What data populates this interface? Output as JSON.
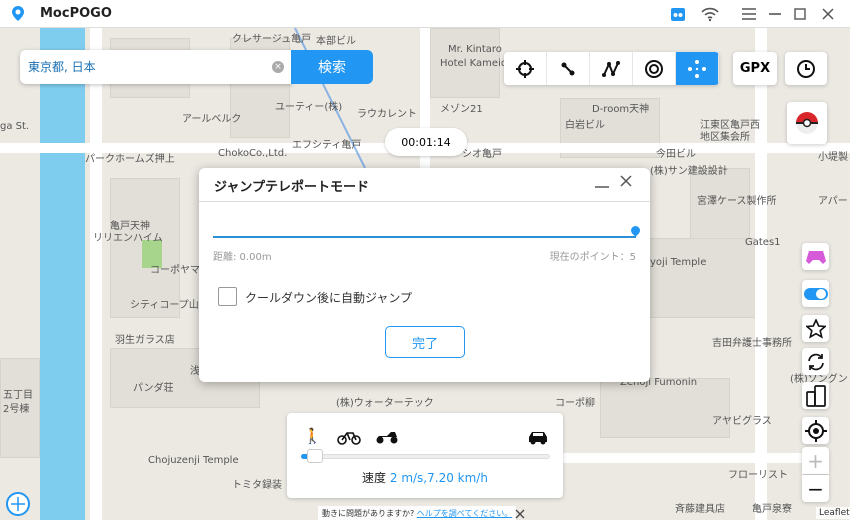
{
  "app": {
    "title": "MocPOGO"
  },
  "titlebar_icons": [
    "robot-icon",
    "wifi-icon",
    "menu-icon",
    "minimize-icon",
    "maximize-icon",
    "close-icon"
  ],
  "search": {
    "value": "東京都, 日本",
    "button": "検索"
  },
  "modes": [
    {
      "icon": "crosshair-icon",
      "active": false
    },
    {
      "icon": "two-point-route-icon",
      "active": false
    },
    {
      "icon": "multi-point-route-icon",
      "active": false
    },
    {
      "icon": "joystick-circle-icon",
      "active": false
    },
    {
      "icon": "jump-teleport-icon",
      "active": true
    }
  ],
  "gpx_label": "GPX",
  "timer": "00:01:14",
  "dialog": {
    "title": "ジャンプテレポートモード",
    "distance": "距離: 0.00m",
    "current_point": "現在のポイント：5",
    "auto_jump_label": "クールダウン後に自動ジャンプ",
    "auto_jump_checked": false,
    "done": "完了"
  },
  "speed": {
    "label": "速度",
    "value": "2 m/s,7.20 km/h",
    "slider_fraction": 0.03
  },
  "help": {
    "text": "動きに問題がありますか?",
    "link": "ヘルプを調べてください。"
  },
  "attribution": "Leaflet",
  "accent": "#2196f3",
  "map_labels": [
    "クレサージュ亀戸",
    "本部ビル",
    "Mr. Kintaro",
    "Hotel Kameido",
    "ユーティー(株)",
    "ラウカレント",
    "メゾン21",
    "D-room天神",
    "アールベルク",
    "白岩ビル",
    "江東区亀戸西",
    "地区集会所",
    "ga St.",
    "パークホームズ押上",
    "ChokoCo.,Ltd.",
    "エフシティ亀戸",
    "シオ亀戸",
    "今田ビル",
    "(株)サン建設設計",
    "小堤製",
    "宮澤ケース製作所",
    "アパー",
    "亀戸天神",
    "リリエンハイム",
    "コーポヤマ",
    "Gates1",
    "yoji Temple",
    "シティコープ山",
    "羽生ガラス店",
    "吉田弁護士事務所",
    "パンダ荘",
    "浅",
    "Zenoji Fumonin",
    "五丁目",
    "2号棟",
    "(株)ウォーターテック",
    "コーポ柳",
    "アヤビグラス",
    "Chojuzenji Temple",
    "トミタ録装",
    "フローリスト",
    "斉藤建具店",
    "亀戸泉寮",
    "(株)ソングン"
  ]
}
